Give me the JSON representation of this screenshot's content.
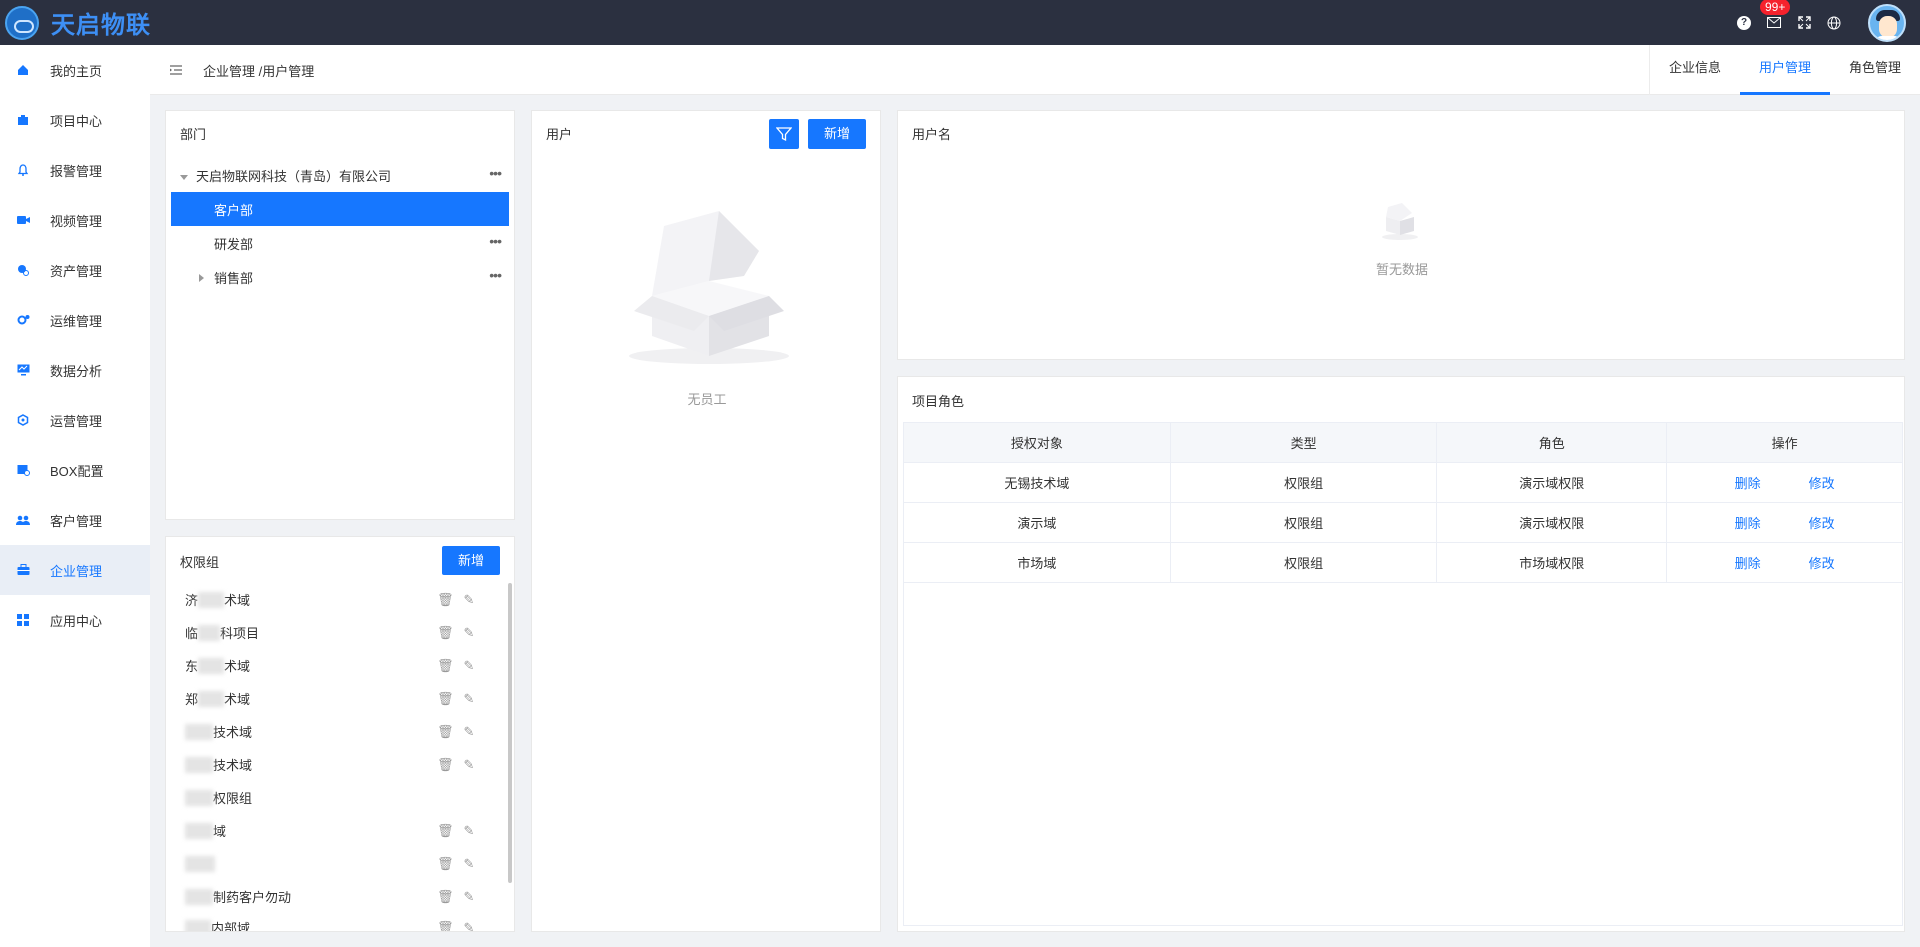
{
  "top": {
    "brand": "天启物联",
    "badge": "99+"
  },
  "sidebar": {
    "items": [
      {
        "label": "我的主页",
        "icon": "home-icon"
      },
      {
        "label": "项目中心",
        "icon": "project-icon"
      },
      {
        "label": "报警管理",
        "icon": "bell-icon"
      },
      {
        "label": "视频管理",
        "icon": "video-icon"
      },
      {
        "label": "资产管理",
        "icon": "asset-icon"
      },
      {
        "label": "运维管理",
        "icon": "maintenance-icon"
      },
      {
        "label": "数据分析",
        "icon": "chart-monitor-icon"
      },
      {
        "label": "运营管理",
        "icon": "operation-icon"
      },
      {
        "label": "BOX配置",
        "icon": "box-icon"
      },
      {
        "label": "客户管理",
        "icon": "customers-icon"
      },
      {
        "label": "企业管理",
        "icon": "enterprise-icon"
      },
      {
        "label": "应用中心",
        "icon": "apps-icon"
      }
    ],
    "active_index": 10
  },
  "header": {
    "breadcrumb": "企业管理 /用户管理",
    "tabs": [
      "企业信息",
      "用户管理",
      "角色管理"
    ],
    "active_tab": 1
  },
  "dept": {
    "title": "部门",
    "root": "天启物联网科技（青岛）有限公司",
    "children": [
      "客户部",
      "研发部",
      "销售部"
    ]
  },
  "perm": {
    "title": "权限组",
    "add_label": "新增",
    "items": [
      {
        "pre": "济",
        "post": "术域"
      },
      {
        "pre": "临",
        "post": "科项目"
      },
      {
        "pre": "东",
        "post": "术域"
      },
      {
        "pre": "郑",
        "post": "术域"
      },
      {
        "pre": "",
        "post": "技术域"
      },
      {
        "pre": "",
        "post": "技术域"
      },
      {
        "pre": "",
        "post": "权限组"
      },
      {
        "pre": "",
        "post": "域"
      },
      {
        "pre": "",
        "post": ""
      },
      {
        "pre": "",
        "post": "制药客户勿动"
      },
      {
        "pre": "",
        "post": "内部域"
      }
    ]
  },
  "users": {
    "title": "用户",
    "add_label": "新增",
    "empty_text": "无员工"
  },
  "username": {
    "title": "用户名",
    "empty_text": "暂无数据"
  },
  "roles": {
    "title": "项目角色",
    "columns": [
      "授权对象",
      "类型",
      "角色",
      "操作"
    ],
    "rows": [
      {
        "target": "无锡技术域",
        "type": "权限组",
        "role": "演示域权限"
      },
      {
        "target": "演示域",
        "type": "权限组",
        "role": "演示域权限"
      },
      {
        "target": "市场域",
        "type": "权限组",
        "role": "市场域权限"
      }
    ],
    "delete_label": "删除",
    "edit_label": "修改"
  }
}
